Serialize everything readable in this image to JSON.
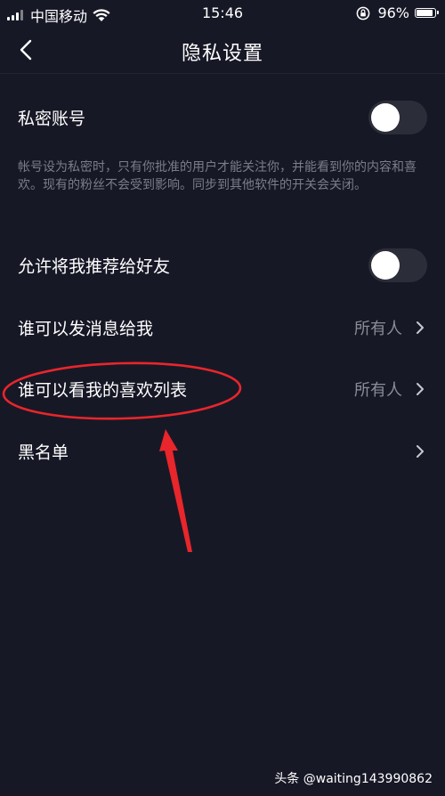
{
  "status_bar": {
    "carrier": "中国移动",
    "time": "15:46",
    "battery": "96%",
    "battery_level": 0.96
  },
  "header": {
    "title": "隐私设置"
  },
  "settings": {
    "private_account": {
      "label": "私密账号",
      "enabled": false
    },
    "private_desc": "帐号设为私密时，只有你批准的用户才能关注你，并能看到你的内容和喜欢。现有的粉丝不会受到影响。同步到其他软件的开关会关闭。",
    "recommend_friends": {
      "label": "允许将我推荐给好友",
      "enabled": false
    },
    "who_can_message": {
      "label": "谁可以发消息给我",
      "value": "所有人"
    },
    "who_can_see_likes": {
      "label": "谁可以看我的喜欢列表",
      "value": "所有人"
    },
    "blacklist": {
      "label": "黑名单"
    }
  },
  "annotation_color": "#e8262b",
  "watermark": "头条 @waiting143990862"
}
